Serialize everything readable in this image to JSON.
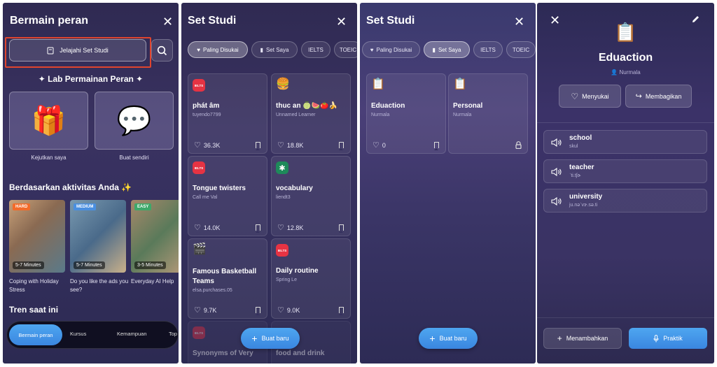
{
  "panel1": {
    "title": "Bermain peran",
    "explore_button": "Jelajahi Set Studi",
    "lab_title": "✦ Lab Permainan Peran ✦",
    "options": [
      {
        "label": "Kejutkan saya",
        "icon": "gift-icon"
      },
      {
        "label": "Buat sendiri",
        "icon": "chat-bubble-icon"
      }
    ],
    "activity_title": "Berdasarkan aktivitas Anda ✨",
    "activities": [
      {
        "level": "HARD",
        "level_color": "#f26b2a",
        "minutes": "5-7 Minutes",
        "caption": "Coping with Holiday Stress"
      },
      {
        "level": "MEDIUM",
        "level_color": "#4a8fe0",
        "minutes": "5-7 Minutes",
        "caption": "Do you like the ads you see?"
      },
      {
        "level": "EASY",
        "level_color": "#3ea86a",
        "minutes": "3-5 Minutes",
        "caption": "Everyday AI Help"
      }
    ],
    "trend_title": "Tren saat ini",
    "bottom_nav": [
      "Bermain peran",
      "Kursus",
      "Kemampuan",
      "Top"
    ]
  },
  "panel2": {
    "title": "Set Studi",
    "filters": [
      "Paling Disukai",
      "Set Saya",
      "IELTS",
      "TOEIC"
    ],
    "cards": [
      {
        "icon": "ielts-badge",
        "title": "phát âm",
        "author": "tuyendo7799",
        "likes": "36.3K"
      },
      {
        "icon": "burger-icon",
        "title": "thuc an 🍈🍉🍅🍌",
        "author": "Unnamed Learner",
        "likes": "18.8K"
      },
      {
        "icon": "ielts-badge",
        "title": "Tongue twisters",
        "author": "Call me Val",
        "likes": "14.0K"
      },
      {
        "icon": "sparkle-icon",
        "title": "vocabulary",
        "author": "liendt3",
        "likes": "12.8K"
      },
      {
        "icon": "clapper-icon",
        "title": "Famous Basketball Teams",
        "author": "elsa.purchases.05",
        "likes": "9.7K"
      },
      {
        "icon": "ielts-badge",
        "title": "Daily routine",
        "author": "Spring Le",
        "likes": "9.0K"
      }
    ],
    "peek_left": "Synonyms of Very",
    "peek_right": "food and drink",
    "fab": "Buat baru"
  },
  "panel3": {
    "title": "Set Studi",
    "filters": [
      "Paling Disukai",
      "Set Saya",
      "IELTS",
      "TOEIC"
    ],
    "cards": [
      {
        "title": "Eduaction",
        "author": "Nurmala",
        "likes": "0"
      },
      {
        "title": "Personal",
        "author": "Nurmala"
      }
    ],
    "fab": "Buat baru"
  },
  "panel4": {
    "title": "Eduaction",
    "author": "Nurmala",
    "like_button": "Menyukai",
    "share_button": "Membagikan",
    "words": [
      {
        "word": "school",
        "phonetic": "skul"
      },
      {
        "word": "teacher",
        "phonetic": "ˈti.tʃɚ"
      },
      {
        "word": "university",
        "phonetic": "ju.nəˈvɝ.sə.ti"
      }
    ],
    "add_button": "Menambahkan",
    "practice_button": "Praktik"
  },
  "colors": {
    "accent": "#3a8ee6",
    "highlight_box": "#e0452e",
    "ielts_red": "#e63343"
  }
}
